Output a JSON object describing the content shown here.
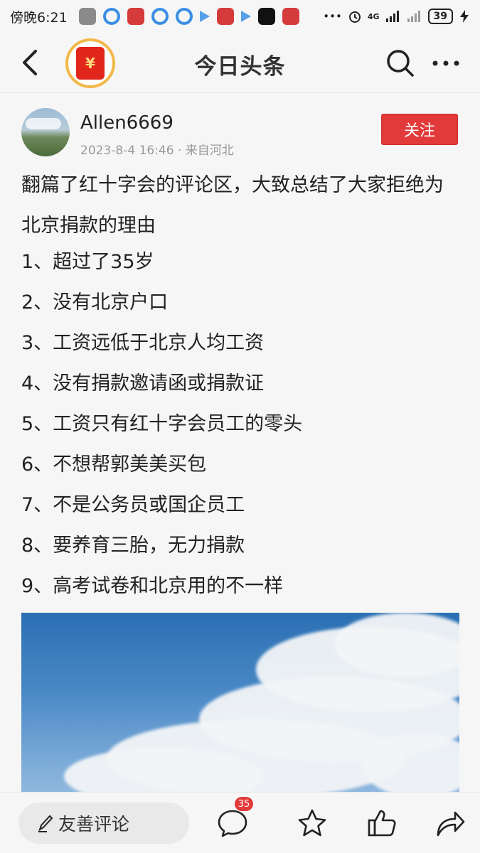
{
  "status_bar": {
    "time": "傍晚6:21",
    "network": "4G",
    "battery": "39"
  },
  "header": {
    "title": "今日头条",
    "logo_glyph": "¥"
  },
  "post": {
    "author": "Allen6669",
    "meta": "2023-8-4 16:46 · 来自河北",
    "follow_label": "关注",
    "intro": "翻篇了红十字会的评论区，大致总结了大家拒绝为北京捐款的理由",
    "reasons": [
      "1、超过了35岁",
      "2、没有北京户口",
      "3、工资远低于北京人均工资",
      "4、没有捐款邀请函或捐款证",
      "5、工资只有红十字会员工的零头",
      "6、不想帮郭美美买包",
      "7、不是公务员或国企员工",
      "8、要养育三胎，无力捐款",
      "9、高考试卷和北京用的不一样"
    ]
  },
  "bottom_bar": {
    "comment_placeholder": "友善评论",
    "comment_count": "35"
  },
  "colors": {
    "accent_red": "#e23a3a",
    "logo_ring": "#f3b84a",
    "background": "#f6f6f6"
  },
  "icons": {
    "back": "chevron-left-icon",
    "search": "search-icon",
    "more": "more-dots-icon",
    "pen": "pen-icon",
    "comment": "comment-bubble-icon",
    "favorite": "star-icon",
    "like": "thumbs-up-icon",
    "share": "share-arrow-icon"
  }
}
